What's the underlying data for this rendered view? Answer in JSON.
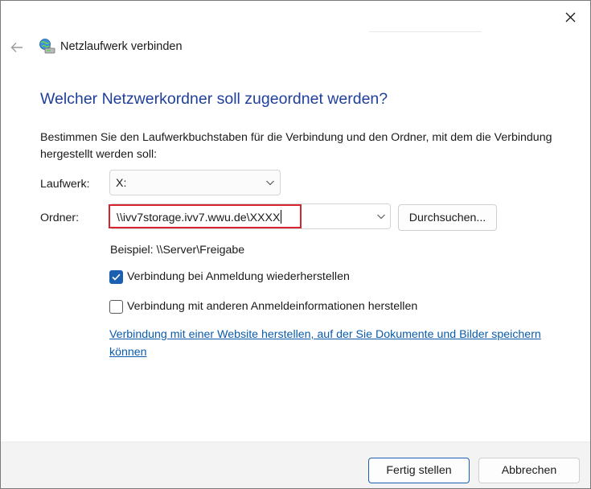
{
  "window": {
    "title": "Netzlaufwerk verbinden"
  },
  "icons": {
    "close": "close-icon",
    "back": "back-arrow-icon",
    "app": "network-drive-icon",
    "dropdown": "chevron-down-icon",
    "check": "checkmark-icon"
  },
  "colors": {
    "heading": "#1f3f9a",
    "link": "#0b5cad",
    "accent": "#1b5fb0",
    "highlight_box": "#d62430",
    "footer_bg": "#f3f3f3"
  },
  "main": {
    "question": "Welcher Netzwerkordner soll zugeordnet werden?",
    "description": "Bestimmen Sie den Laufwerkbuchstaben für die Verbindung und den Ordner, mit dem die Verbindung hergestellt werden soll:",
    "drive_label": "Laufwerk:",
    "drive_value": "X:",
    "folder_label": "Ordner:",
    "folder_value": "\\\\ivv7storage.ivv7.wwu.de\\XXXX",
    "browse_label": "Durchsuchen...",
    "example": "Beispiel: \\\\Server\\Freigabe",
    "reconnect_label": "Verbindung bei Anmeldung wiederherstellen",
    "reconnect_checked": true,
    "other_credentials_label": "Verbindung mit anderen Anmeldeinformationen herstellen",
    "other_credentials_checked": false,
    "website_link": "Verbindung mit einer Website herstellen, auf der Sie Dokumente und Bilder speichern können"
  },
  "footer": {
    "finish_label": "Fertig stellen",
    "cancel_label": "Abbrechen"
  }
}
